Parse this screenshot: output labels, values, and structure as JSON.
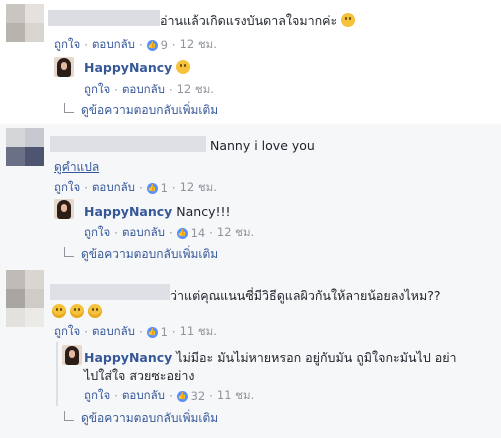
{
  "comments": [
    {
      "text": "อ่านแล้วเกิดแรงบันดาลใจมากค่ะ",
      "actions": {
        "like": "ถูกใจ",
        "reply": "ตอบกลับ",
        "likes": "9",
        "time": "12 ชม."
      },
      "reply": {
        "author": "HappyNancy",
        "text": "",
        "actions": {
          "like": "ถูกใจ",
          "reply": "ตอบกลับ",
          "likes": "",
          "time": "12 ชม."
        }
      },
      "more_replies": "ดูข้อความตอบกลับเพิ่มเติม"
    },
    {
      "text": "Nanny i love you",
      "translate": "ดูคำแปล",
      "actions": {
        "like": "ถูกใจ",
        "reply": "ตอบกลับ",
        "likes": "1",
        "time": "12 ชม."
      },
      "reply": {
        "author": "HappyNancy",
        "text": "Nancy!!!",
        "actions": {
          "like": "ถูกใจ",
          "reply": "ตอบกลับ",
          "likes": "14",
          "time": "12 ชม."
        }
      },
      "more_replies": "ดูข้อความตอบกลับเพิ่มเติม"
    },
    {
      "text": "ว่าแต่คุณแนนซี่มีวิธีดูแลผิวกันให้ลายน้อยลงไหม??",
      "actions": {
        "like": "ถูกใจ",
        "reply": "ตอบกลับ",
        "likes": "1",
        "time": "11 ชม."
      },
      "reply": {
        "author": "HappyNancy",
        "text": "ไม่มีอะ มันไม่หายหรอก อยู่กับมัน ถูมิใจกะมันไป อย่า",
        "text2": "ไปใส่ใจ สวยซะอย่าง",
        "actions": {
          "like": "ถูกใจ",
          "reply": "ตอบกลับ",
          "likes": "32",
          "time": "11 ชม."
        }
      },
      "more_replies": "ดูข้อความตอบกลับเพิ่มเติม"
    }
  ],
  "colors": {
    "link": "#365899",
    "meta": "#90949c",
    "like_badge": "#5890ff",
    "thread_bg": "#f6f7f9"
  }
}
